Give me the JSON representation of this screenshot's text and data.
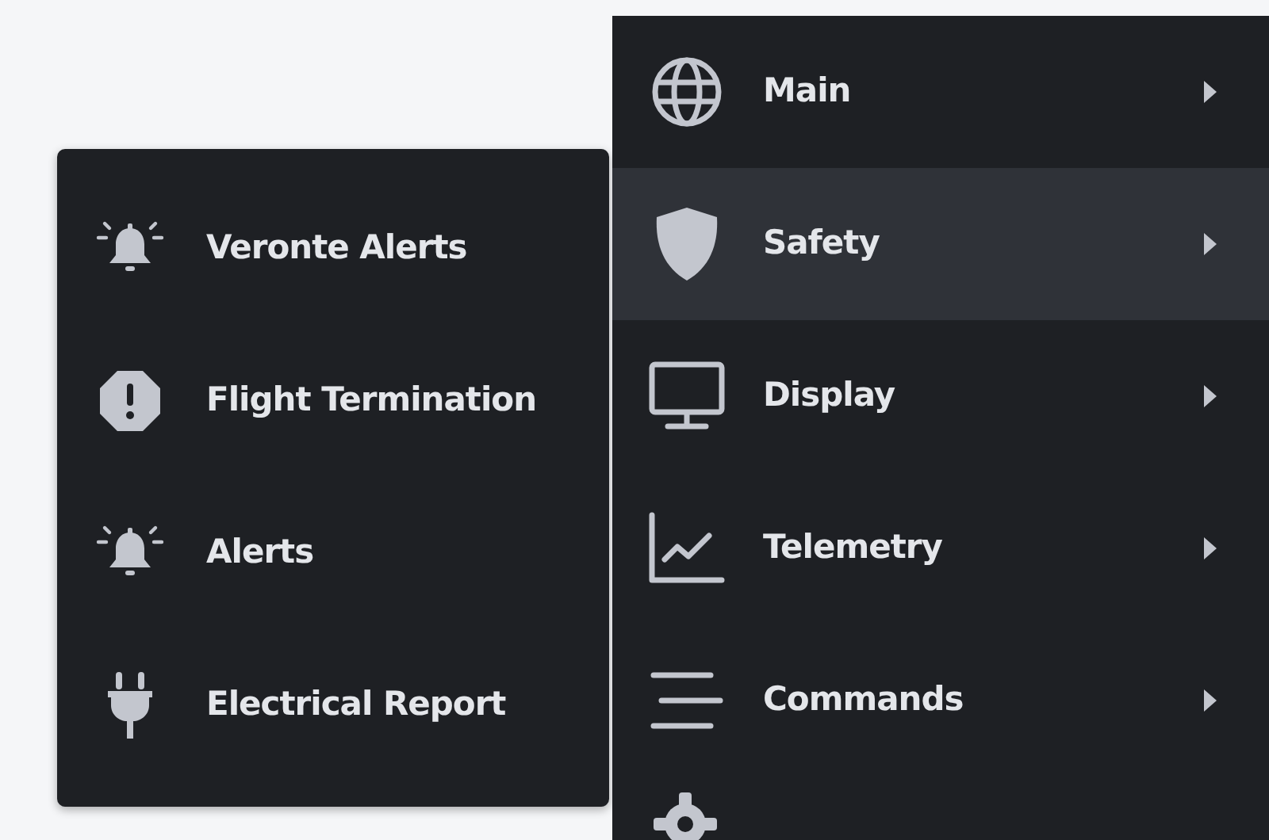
{
  "submenu": {
    "items": [
      {
        "label": "Veronte Alerts"
      },
      {
        "label": "Flight Termination"
      },
      {
        "label": "Alerts"
      },
      {
        "label": "Electrical Report"
      }
    ]
  },
  "main_menu": {
    "items": [
      {
        "label": "Main",
        "selected": false
      },
      {
        "label": "Safety",
        "selected": true
      },
      {
        "label": "Display",
        "selected": false
      },
      {
        "label": "Telemetry",
        "selected": false
      },
      {
        "label": "Commands",
        "selected": false
      }
    ]
  }
}
